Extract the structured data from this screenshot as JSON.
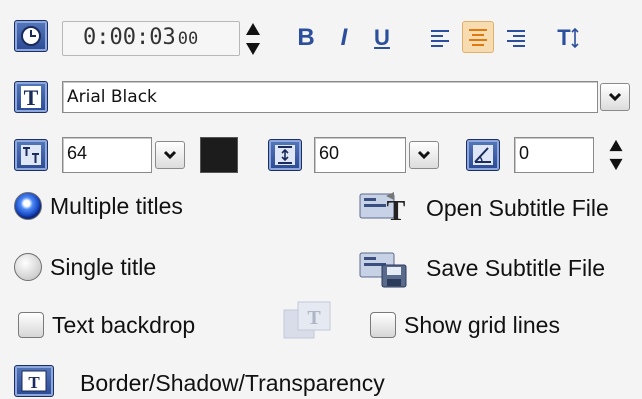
{
  "time": {
    "value": "0:00:03",
    "frames": "00"
  },
  "format": {
    "bold_label": "B",
    "italic_label": "I",
    "underline_label": "U",
    "text_direction_label": "T",
    "active_alignment": "center"
  },
  "font": {
    "name": "Arial Black"
  },
  "size": {
    "font_size": "64",
    "text_color": "#1c1c1c",
    "line_spacing": "60",
    "angle": "0"
  },
  "title_mode": {
    "multiple_label": "Multiple titles",
    "single_label": "Single title",
    "selected": "multiple"
  },
  "subtitle": {
    "open_label": "Open Subtitle File",
    "save_label": "Save Subtitle File"
  },
  "options": {
    "text_backdrop_label": "Text backdrop",
    "show_grid_label": "Show grid lines"
  },
  "effects": {
    "border_label": "Border/Shadow/Transparency"
  },
  "colors": {
    "accent": "#2b4f9c",
    "active_bg": "#f6dcb0"
  }
}
